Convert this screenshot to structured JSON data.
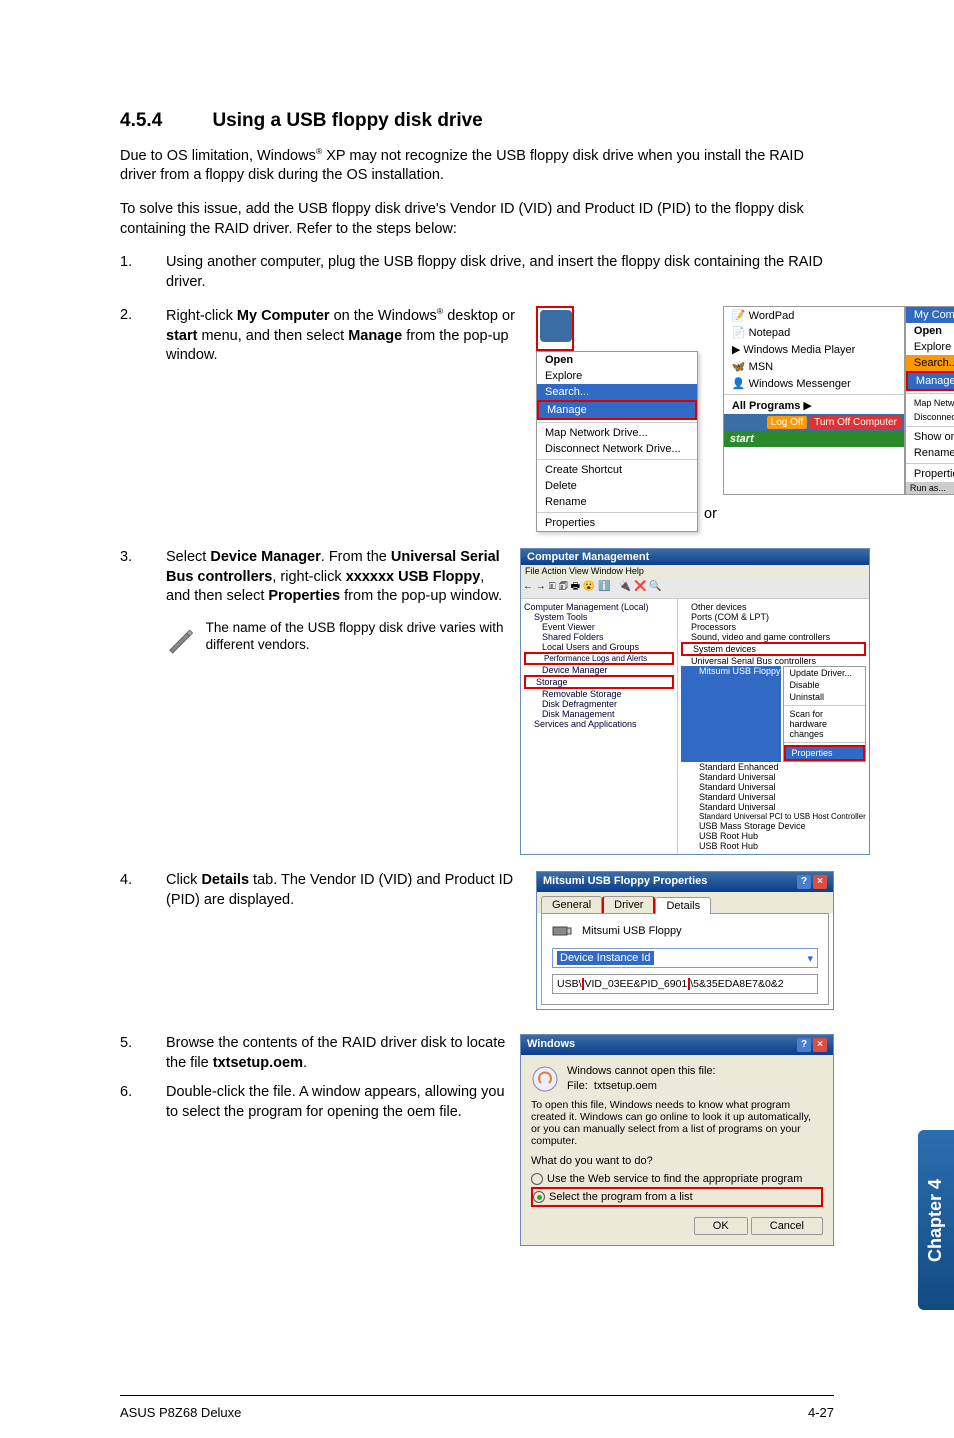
{
  "heading": {
    "num": "4.5.4",
    "title": "Using a USB floppy disk drive"
  },
  "p1_a": "Due to OS limitation, Windows",
  "p1_b": " XP may not recognize the USB floppy disk drive when you install the RAID driver from a floppy disk during the OS installation.",
  "p2": "To solve this issue, add the USB floppy disk drive's Vendor ID (VID) and Product ID (PID) to the floppy disk containing the RAID driver. Refer to the steps below:",
  "steps": {
    "s1": {
      "num": "1.",
      "text": "Using another computer, plug the USB floppy disk drive, and insert the floppy disk containing the RAID driver."
    },
    "s2": {
      "num": "2.",
      "a": "Right-click ",
      "b": "My Computer",
      "c": " on the Windows",
      "d": " desktop or ",
      "e": "start",
      "f": " menu, and then select ",
      "g": "Manage",
      "h": " from the pop-up window."
    },
    "s3": {
      "num": "3.",
      "a": "Select ",
      "b": "Device Manager",
      "c": ". From the ",
      "d": "Universal Serial Bus controllers",
      "e": ", right-click ",
      "f": "xxxxxx USB Floppy",
      "g": ", and then select ",
      "h": "Properties",
      "i": " from the pop-up window."
    },
    "s4": {
      "num": "4.",
      "a": "Click ",
      "b": "Details",
      "c": " tab. The Vendor ID (VID) and Product ID (PID) are displayed."
    },
    "s5": {
      "num": "5.",
      "a": "Browse the contents of the RAID driver disk to locate the file ",
      "b": "txtsetup.oem",
      "c": "."
    },
    "s6": {
      "num": "6.",
      "text": "Double-click the file. A window appears, allowing you to select the program for opening the oem file."
    }
  },
  "note": "The name of the USB floppy disk drive varies with different vendors.",
  "or": "or",
  "ctxmenu": {
    "open": "Open",
    "explore": "Explore",
    "search": "Search...",
    "manage": "Manage",
    "mapnet": "Map Network Drive...",
    "discnet": "Disconnect Network Drive...",
    "shortcut": "Create Shortcut",
    "delete": "Delete",
    "rename": "Rename",
    "props": "Properties"
  },
  "startmenu": {
    "wordpad": "WordPad",
    "notepad": "Notepad",
    "wmp": "Windows Media Player",
    "msn": "MSN",
    "winmsg": "Windows Messenger",
    "allprog": "All Programs",
    "logoff": "Log Off",
    "turnoff": "Turn Off Computer",
    "start": "start"
  },
  "submenu": {
    "mycomp": "My Computer",
    "open": "Open",
    "explore": "Explore",
    "search": "Search...",
    "manage": "Manage",
    "mapnet": "Map Network Drive...",
    "discnet": "Disconnect Network Drive...",
    "showdesk": "Show on Desktop",
    "rename": "Rename",
    "props": "Properties",
    "runas": "Run as..."
  },
  "devmgr": {
    "title": "Computer Management",
    "filemenu": "File   Action   View   Window   Help",
    "left": [
      "Computer Management (Local)",
      "System Tools",
      "Event Viewer",
      "Shared Folders",
      "Local Users and Groups",
      "Performance Logs and Alerts",
      "Device Manager",
      "Storage",
      "Removable Storage",
      "Disk Defragmenter",
      "Disk Management",
      "Services and Applications"
    ],
    "right": [
      "Other devices",
      "Ports (COM & LPT)",
      "Processors",
      "Sound, video and game controllers",
      "System devices",
      "Universal Serial Bus controllers",
      "Mitsumi USB Floppy",
      "Standard Enhanced",
      "Standard Universal",
      "Standard Universal",
      "Standard Universal",
      "Standard Universal",
      "Standard Universal PCI to USB Host Controller",
      "USB Mass Storage Device",
      "USB Root Hub",
      "USB Root Hub"
    ],
    "ctx": {
      "update": "Update Driver...",
      "disable": "Disable",
      "uninstall": "Uninstall",
      "scan": "Scan for hardware changes",
      "props": "Properties"
    }
  },
  "propdlg": {
    "title": "Mitsumi USB Floppy Properties",
    "tabs": {
      "general": "General",
      "driver": "Driver",
      "details": "Details"
    },
    "devname": "Mitsumi USB Floppy",
    "combo": "Device Instance Id",
    "value": "USB\\VID_03EE&PID_6901\\5&35EDA8E7&0&2"
  },
  "windlg": {
    "title": "Windows",
    "line1": "Windows cannot open this file:",
    "filelabel": "File:",
    "filename": "txtsetup.oem",
    "line2": "To open this file, Windows needs to know what program created it. Windows can go online to look it up automatically, or you can manually select from a list of programs on your computer.",
    "line3": "What do you want to do?",
    "opt1": "Use the Web service to find the appropriate program",
    "opt2": "Select the program from a list",
    "ok": "OK",
    "cancel": "Cancel"
  },
  "chapter": "Chapter 4",
  "footer": {
    "left": "ASUS P8Z68 Deluxe",
    "right": "4-27"
  }
}
